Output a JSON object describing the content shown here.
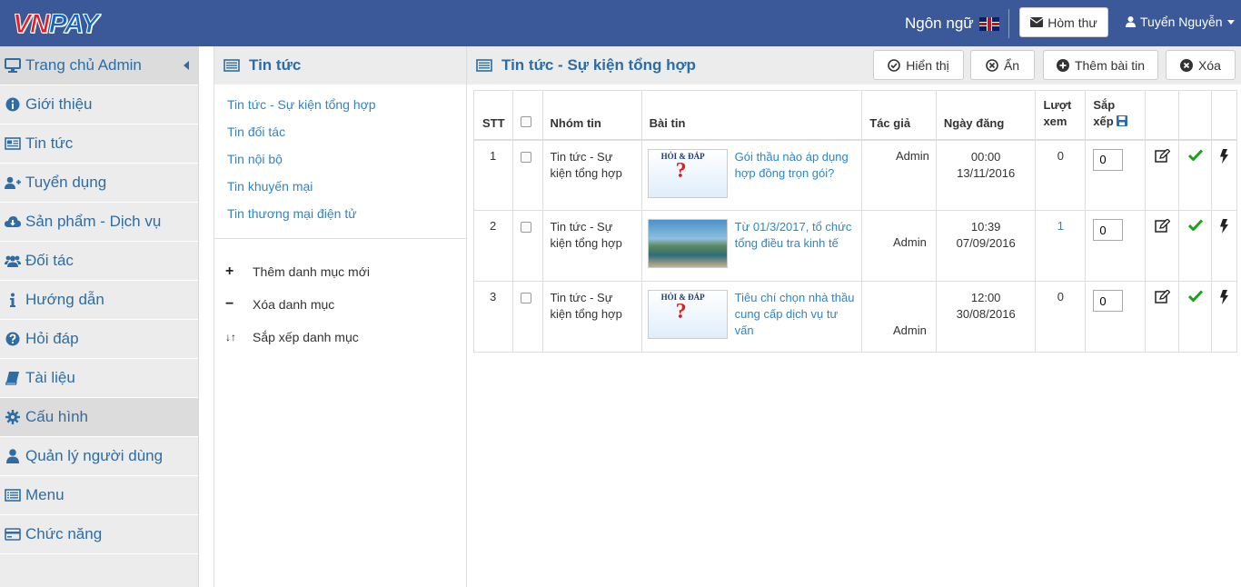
{
  "header": {
    "logo_vn": "VN",
    "logo_pay": "PAY",
    "language_label": "Ngôn ngữ",
    "mailbox_label": "Hòm thư",
    "user_name": "Tuyển Nguyễn"
  },
  "sidebar": {
    "items": [
      {
        "label": "Trang chủ Admin",
        "icon": "monitor-icon"
      },
      {
        "label": "Giới thiệu",
        "icon": "info-icon"
      },
      {
        "label": "Tin tức",
        "icon": "newspaper-icon"
      },
      {
        "label": "Tuyển dụng",
        "icon": "add-user-icon"
      },
      {
        "label": "Sản phẩm - Dịch vụ",
        "icon": "cloud-download-icon"
      },
      {
        "label": "Đối tác",
        "icon": "users-icon"
      },
      {
        "label": "Hướng dẫn",
        "icon": "info-small-icon"
      },
      {
        "label": "Hỏi đáp",
        "icon": "question-icon"
      },
      {
        "label": "Tài liệu",
        "icon": "book-icon"
      },
      {
        "label": "Cấu hình",
        "icon": "gear-icon"
      },
      {
        "label": "Quản lý người dùng",
        "icon": "user-icon"
      },
      {
        "label": "Menu",
        "icon": "list-icon"
      },
      {
        "label": "Chức năng",
        "icon": "card-icon"
      }
    ]
  },
  "category_panel": {
    "title": "Tin tức",
    "categories": [
      "Tin tức - Sự kiện tổng hợp",
      "Tin đối tác",
      "Tin nội bộ",
      "Tin khuyến mại",
      "Tin thương mại điện tử"
    ],
    "actions": [
      {
        "symbol": "+",
        "label": "Thêm danh mục mới"
      },
      {
        "symbol": "−",
        "label": "Xóa danh mục"
      },
      {
        "symbol": "↓↑",
        "label": "Sắp xếp danh mục"
      }
    ]
  },
  "main": {
    "title": "Tin tức - Sự kiện tổng hợp",
    "toolbar": {
      "show_label": "Hiển thị",
      "hide_label": "Ẩn",
      "add_label": "Thêm bài tin",
      "delete_label": "Xóa"
    },
    "table": {
      "headers": {
        "stt": "STT",
        "group": "Nhóm tin",
        "article": "Bài tin",
        "author": "Tác giả",
        "date": "Ngày đăng",
        "views_1": "Lượt",
        "views_2": "xem",
        "order_1": "Sắp",
        "order_2": "xếp"
      },
      "rows": [
        {
          "stt": "1",
          "group": "Tin tức - Sự kiện tổng hợp",
          "title": "Gói thầu nào áp dụng hợp đồng trọn gói?",
          "author": "Admin",
          "time": "00:00",
          "date": "13/11/2016",
          "views": "0",
          "order": "0",
          "thumb": "hoi-dap"
        },
        {
          "stt": "2",
          "group": "Tin tức - Sự kiện tổng hợp",
          "title": "Từ 01/3/2017, tổ chức tổng điều tra kinh tế",
          "author": "Admin",
          "time": "10:39",
          "date": "07/09/2016",
          "views": "1",
          "order": "0",
          "thumb": "sea"
        },
        {
          "stt": "3",
          "group": "Tin tức - Sự kiện tổng hợp",
          "title": "Tiêu chí chọn nhà thầu cung cấp dịch vụ tư vấn",
          "author": "Admin",
          "time": "12:00",
          "date": "30/08/2016",
          "views": "0",
          "order": "0",
          "thumb": "hoi-dap"
        }
      ],
      "thumb_text": "HỎI & ĐÁP"
    }
  },
  "colors": {
    "header_bg": "#3b5998",
    "link": "#2e85c7",
    "sidebar_text": "#2e6da4",
    "check_green": "#1aa31a"
  }
}
